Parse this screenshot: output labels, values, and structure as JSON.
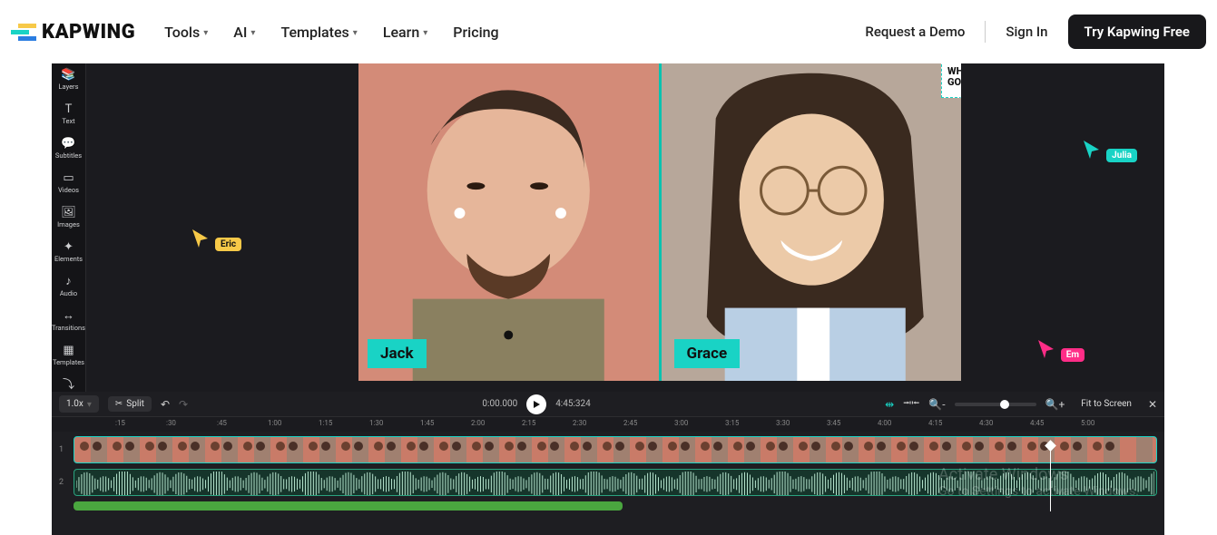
{
  "brand": "KAPWING",
  "nav": {
    "links": [
      "Tools",
      "AI",
      "Templates",
      "Learn",
      "Pricing"
    ],
    "demo": "Request a Demo",
    "signin": "Sign In",
    "cta": "Try Kapwing Free"
  },
  "sidebar": [
    {
      "icon": "📚",
      "label": "Layers"
    },
    {
      "icon": "T",
      "label": "Text"
    },
    {
      "icon": "💬",
      "label": "Subtitles"
    },
    {
      "icon": "▭",
      "label": "Videos"
    },
    {
      "icon": "🖼",
      "label": "Images"
    },
    {
      "icon": "✦",
      "label": "Elements"
    },
    {
      "icon": "♪",
      "label": "Audio"
    },
    {
      "icon": "↔",
      "label": "Transitions"
    },
    {
      "icon": "▦",
      "label": "Templates"
    },
    {
      "icon": "⤵",
      "label": ""
    }
  ],
  "preview": {
    "left_name": "Jack",
    "right_name": "Grace",
    "speech": "WHAT'S GOING ON"
  },
  "cursors": {
    "eric": "Eric",
    "julia": "Julia",
    "em": "Em"
  },
  "controls": {
    "speed": "1.0x",
    "split": "Split",
    "time_current": "0:00.000",
    "time_total": "4:45:324",
    "fit": "Fit to Screen"
  },
  "ruler": [
    ":15",
    ":30",
    ":45",
    "1:00",
    "1:15",
    "1:30",
    "1:45",
    "2:00",
    "2:15",
    "2:30",
    "2:45",
    "3:00",
    "3:15",
    "3:30",
    "3:45",
    "4:00",
    "4:15",
    "4:30",
    "4:45",
    "5:00"
  ],
  "tracks": {
    "t1": "1",
    "t2": "2"
  },
  "watermark": {
    "line1": "Activate Windows",
    "line2": "Go to Settings to activate Windows."
  },
  "colors": {
    "teal": "#19d3c5",
    "yellow": "#f7c948",
    "pink": "#ff2d87"
  }
}
